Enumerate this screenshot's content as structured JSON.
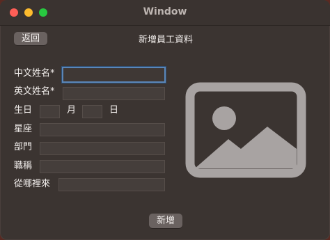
{
  "window": {
    "title": "Window"
  },
  "toolbar": {
    "back_label": "返回"
  },
  "page": {
    "heading": "新增員工資料"
  },
  "form": {
    "chinese_name_label": "中文姓名*",
    "english_name_label": "英文姓名*",
    "birthday_label": "生日",
    "month_label": "月",
    "day_label": "日",
    "zodiac_label": "星座",
    "department_label": "部門",
    "job_title_label": "職稱",
    "origin_label": "從哪裡來",
    "chinese_name_value": "",
    "english_name_value": "",
    "birth_month_value": "",
    "birth_day_value": "",
    "zodiac_value": "",
    "department_value": "",
    "job_title_value": "",
    "origin_value": ""
  },
  "footer": {
    "add_label": "新增"
  },
  "icons": {
    "photo": "photo-placeholder-icon",
    "close": "close-icon",
    "minimize": "minimize-icon",
    "maximize": "maximize-icon"
  },
  "colors": {
    "window_bg": "#3b3431",
    "field_bg": "#453e3b",
    "focus_ring": "#5a86b8",
    "button_bg": "#6a6260",
    "text": "#f2eeec",
    "close": "#fe5f57",
    "minimize": "#febc2e",
    "maximize": "#28c840"
  }
}
